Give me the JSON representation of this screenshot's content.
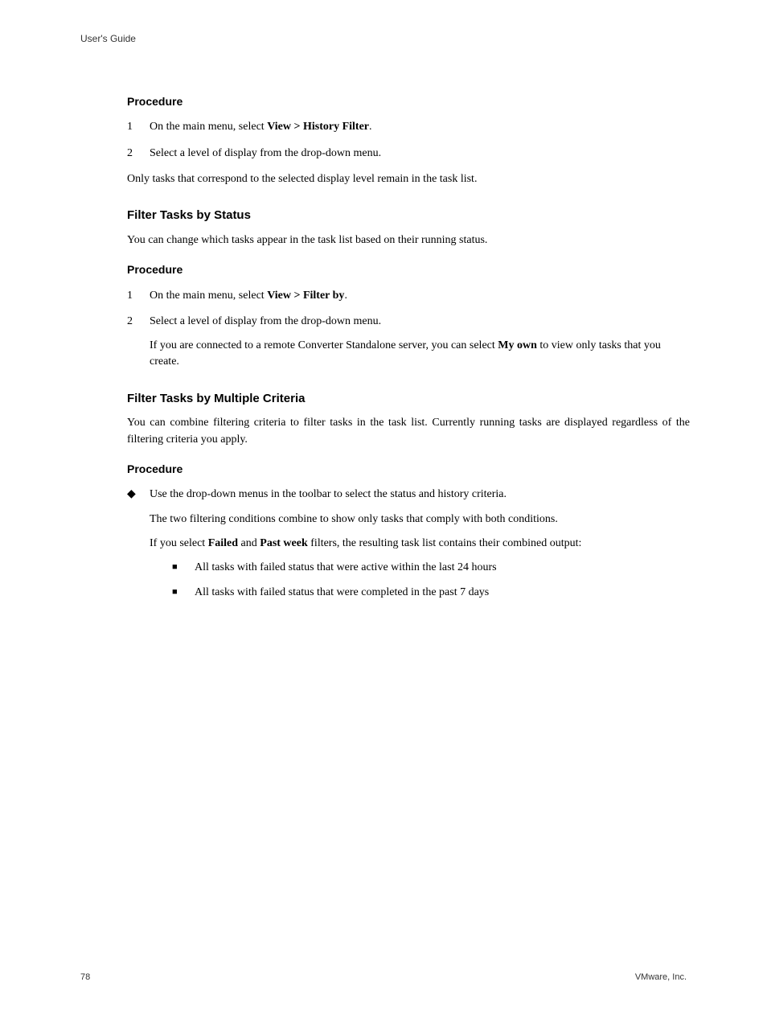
{
  "header": "User's Guide",
  "sec1": {
    "procLabel": "Procedure",
    "step1_pre": "On the main menu, select ",
    "step1_bold": "View > History Filter",
    "step1_post": ".",
    "step2": "Select a level of display from the drop-down menu.",
    "after": "Only tasks that correspond to the selected display level remain in the task list."
  },
  "sec2": {
    "heading": "Filter Tasks by Status",
    "intro": "You can change which tasks appear in the task list based on their running status.",
    "procLabel": "Procedure",
    "step1_pre": "On the main menu, select ",
    "step1_bold": "View > Filter by",
    "step1_post": ".",
    "step2": "Select a level of display from the drop-down menu.",
    "step2_sub_pre": "If you are connected to a remote Converter Standalone server, you can select ",
    "step2_sub_bold": "My own",
    "step2_sub_post": " to view only tasks that you create."
  },
  "sec3": {
    "heading": "Filter Tasks by Multiple Criteria",
    "intro": "You can combine filtering criteria to filter tasks in the task list. Currently running tasks are displayed regardless of the filtering criteria you apply.",
    "procLabel": "Procedure",
    "bullet1": "Use the drop-down menus in the toolbar to select the status and history criteria.",
    "bullet1_p2": "The two filtering conditions combine to show only tasks that comply with both conditions.",
    "bullet1_p3_pre": "If you select ",
    "bullet1_p3_b1": "Failed",
    "bullet1_p3_mid": " and ",
    "bullet1_p3_b2": "Past week",
    "bullet1_p3_post": " filters, the resulting task list contains their combined output:",
    "sub1": "All tasks with failed status that were active within the last 24 hours",
    "sub2": "All tasks with failed status that were completed in the past 7 days"
  },
  "footer": {
    "page": "78",
    "company": "VMware, Inc."
  },
  "nums": {
    "one": "1",
    "two": "2"
  },
  "bullets": {
    "diamond": "◆",
    "square": "■"
  }
}
